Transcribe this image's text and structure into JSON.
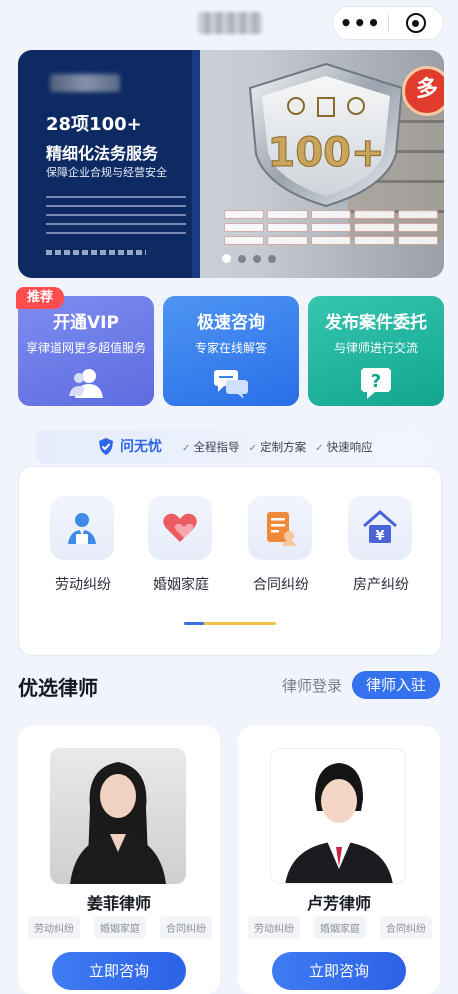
{
  "banner": {
    "headline": "28项100+",
    "headline2": "精细化法务服务",
    "subtitle": "保障企业合规与经营安全",
    "shield_text": "100+",
    "badge": "多"
  },
  "services": [
    {
      "title": "开通VIP",
      "subtitle": "享律道网更多超值服务",
      "icon": "user-group-icon"
    },
    {
      "title": "极速咨询",
      "subtitle": "专家在线解答",
      "icon": "chat-bubbles-icon"
    },
    {
      "title": "发布案件委托",
      "subtitle": "与律师进行交流",
      "icon": "question-bubble-icon"
    }
  ],
  "recommend_badge": "推荐",
  "wuyou": {
    "brand": "问无忧",
    "items": [
      "全程指导",
      "定制方案",
      "快速响应"
    ]
  },
  "categories": [
    {
      "label": "劳动纠纷",
      "icon": "labor-worker-icon"
    },
    {
      "label": "婚姻家庭",
      "icon": "heart-icon"
    },
    {
      "label": "合同纠纷",
      "icon": "contract-document-icon"
    },
    {
      "label": "房产纠纷",
      "icon": "house-yuan-icon"
    }
  ],
  "lawyers_section": {
    "title": "优选律师",
    "login_label": "律师登录",
    "join_label": "律师入驻"
  },
  "lawyers": [
    {
      "name": "姜菲律师",
      "tags": [
        "劳动纠纷",
        "婚姻家庭",
        "合同纠纷"
      ],
      "button": "立即咨询"
    },
    {
      "name": "卢芳律师",
      "tags": [
        "劳动纠纷",
        "婚姻家庭",
        "合同纠纷"
      ],
      "button": "立即咨询"
    }
  ],
  "colors": {
    "accent": "#3572f0",
    "vip": "#6f7ce8",
    "consult": "#3a80ee",
    "publish": "#1eb39d",
    "badge_red": "#ff4d4f"
  }
}
